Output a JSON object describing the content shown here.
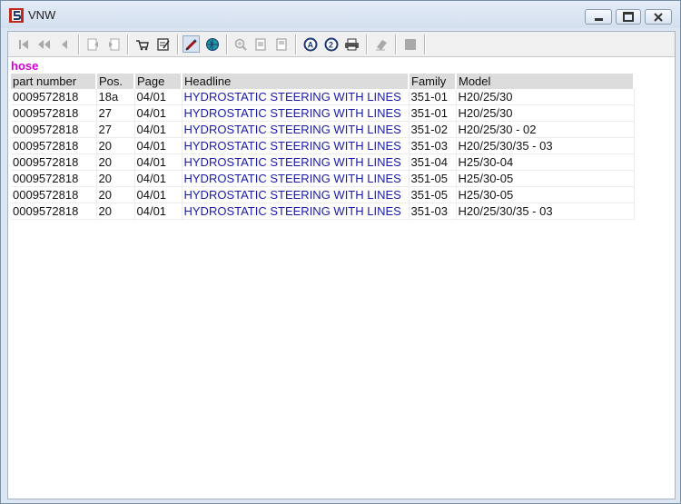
{
  "window": {
    "title": "VNW"
  },
  "query_label": "hose",
  "table": {
    "columns": [
      "part number",
      "Pos.",
      "Page",
      "Headline",
      "Family",
      "Model"
    ],
    "rows": [
      [
        "0009572818",
        "18a",
        "04/01",
        "HYDROSTATIC STEERING WITH LINES",
        "351-01",
        "H20/25/30"
      ],
      [
        "0009572818",
        "27",
        "04/01",
        "HYDROSTATIC STEERING WITH LINES",
        "351-01",
        "H20/25/30"
      ],
      [
        "0009572818",
        "27",
        "04/01",
        "HYDROSTATIC STEERING WITH LINES",
        "351-02",
        "H20/25/30 - 02"
      ],
      [
        "0009572818",
        "20",
        "04/01",
        "HYDROSTATIC STEERING WITH LINES",
        "351-03",
        "H20/25/30/35 - 03"
      ],
      [
        "0009572818",
        "20",
        "04/01",
        "HYDROSTATIC STEERING WITH LINES",
        "351-04",
        "H25/30-04"
      ],
      [
        "0009572818",
        "20",
        "04/01",
        "HYDROSTATIC STEERING WITH LINES",
        "351-05",
        "H25/30-05"
      ],
      [
        "0009572818",
        "20",
        "04/01",
        "HYDROSTATIC STEERING WITH LINES",
        "351-05",
        "H25/30-05"
      ],
      [
        "0009572818",
        "20",
        "04/01",
        "HYDROSTATIC STEERING WITH LINES",
        "351-03",
        "H20/25/30/35 - 03"
      ]
    ]
  },
  "toolbar_icons": [
    "first-page-icon",
    "previous-fast-icon",
    "previous-icon",
    "page-back-icon",
    "page-forward-icon",
    "cart-icon",
    "edit-list-icon",
    "pen-icon",
    "globe-icon",
    "zoom-icon",
    "page-icon",
    "page-alt-icon",
    "search-a-icon",
    "search-2-icon",
    "print-icon",
    "eraser-icon",
    "stop-icon"
  ],
  "colors": {
    "query": "#d400d4",
    "headline_link": "#1a1aa8",
    "header_bg": "#dcdcdc"
  }
}
